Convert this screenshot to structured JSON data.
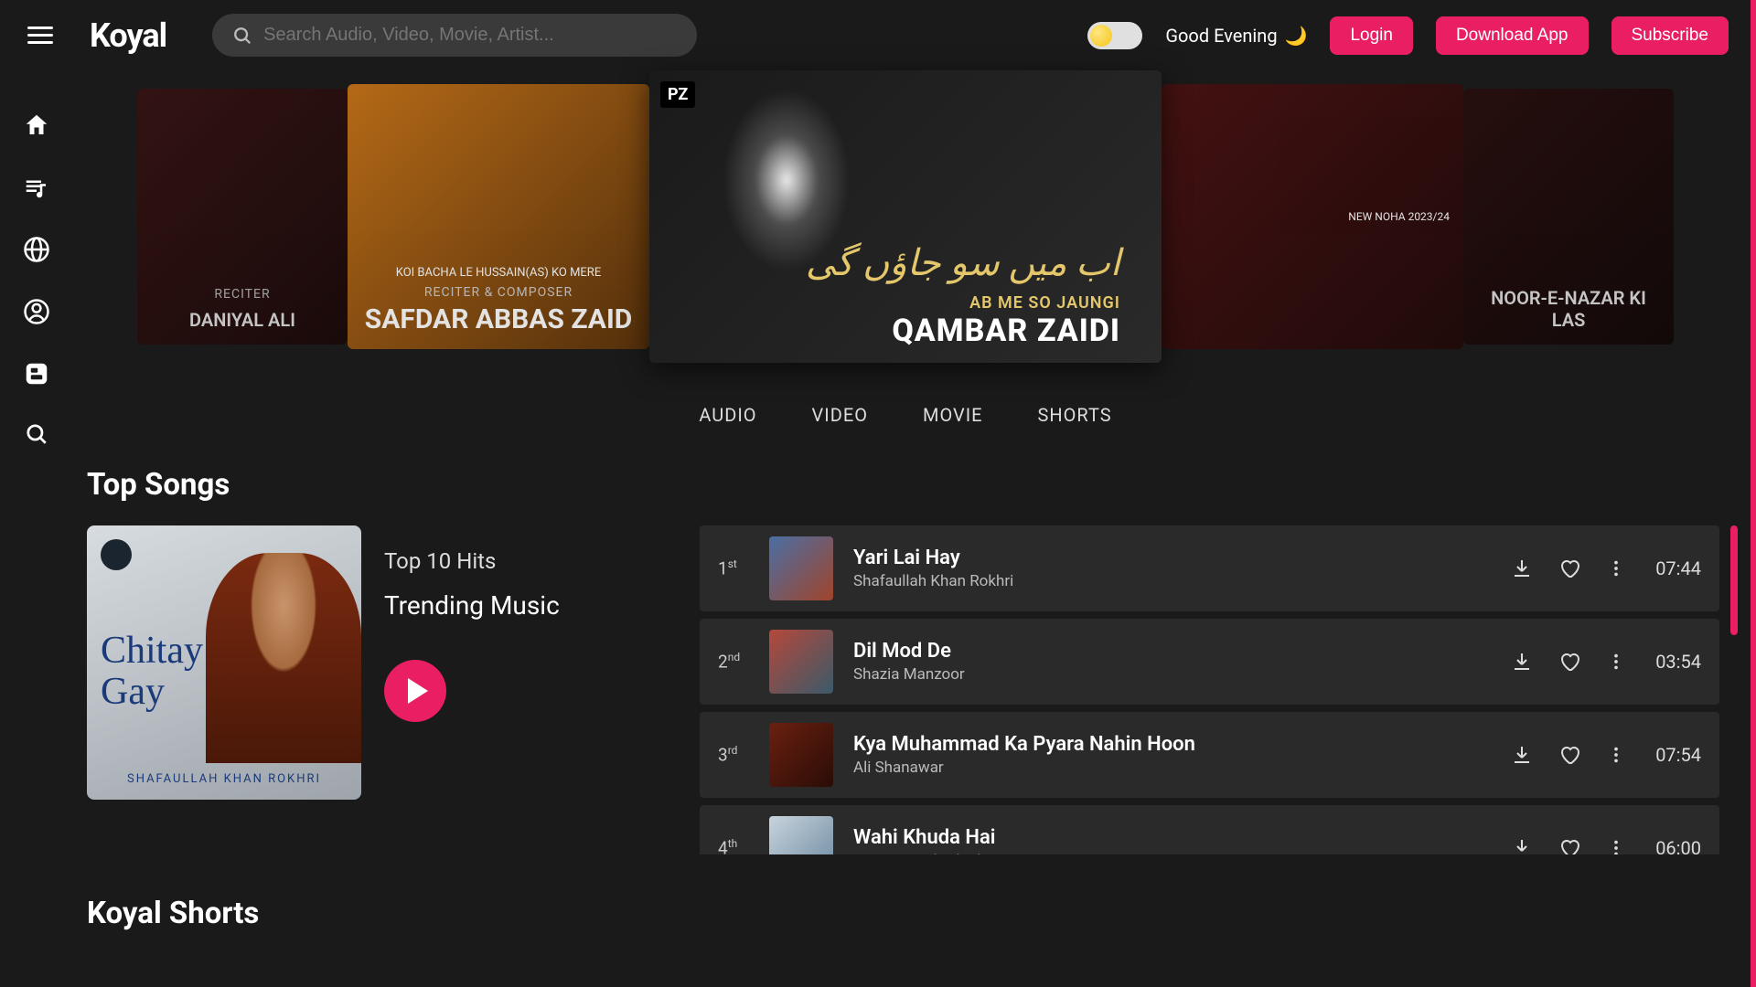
{
  "brand": "Koyal",
  "search": {
    "placeholder": "Search Audio, Video, Movie, Artist..."
  },
  "greeting": "Good Evening",
  "header_buttons": {
    "login": "Login",
    "download": "Download App",
    "subscribe": "Subscribe"
  },
  "hero": {
    "badge": "PZ",
    "cards": [
      {
        "reciter_label": "RECITER",
        "reciter": "DANIYAL ALI"
      },
      {
        "top": "KOI BACHA LE HUSSAIN(AS) KO MERE",
        "label": "RECITER & COMPOSER",
        "name": "SAFDAR ABBAS ZAID"
      },
      {
        "script": "اب میں سو جاؤں گی",
        "sub": "AB ME SO JAUNGI",
        "name": "QAMBAR ZAIDI"
      },
      {
        "tag": "NEW NOHA 2023/24"
      },
      {
        "title": "NOOR-E-NAZAR KI LAS"
      }
    ]
  },
  "tabs": [
    "AUDIO",
    "VIDEO",
    "MOVIE",
    "SHORTS"
  ],
  "sections": {
    "top_songs": "Top Songs",
    "shorts": "Koyal Shorts"
  },
  "top10": {
    "label": "Top 10 Hits",
    "name": "Trending Music",
    "cover_text": "Chitay Wal The Gay",
    "cover_footer": "SHAFAULLAH KHAN ROKHRI"
  },
  "songs": [
    {
      "rank": "1",
      "ord": "st",
      "title": "Yari Lai Hay",
      "artist": "Shafaullah Khan Rokhri",
      "dur": "07:44",
      "thumb": "th1"
    },
    {
      "rank": "2",
      "ord": "nd",
      "title": "Dil Mod De",
      "artist": "Shazia Manzoor",
      "dur": "03:54",
      "thumb": "th2"
    },
    {
      "rank": "3",
      "ord": "rd",
      "title": "Kya Muhammad Ka Pyara Nahin Hoon",
      "artist": "Ali Shanawar",
      "dur": "07:54",
      "thumb": "th3"
    },
    {
      "rank": "4",
      "ord": "th",
      "title": "Wahi Khuda Hai",
      "artist": "Nusrat Fateh Ali Khan",
      "dur": "06:00",
      "thumb": "th4"
    }
  ]
}
